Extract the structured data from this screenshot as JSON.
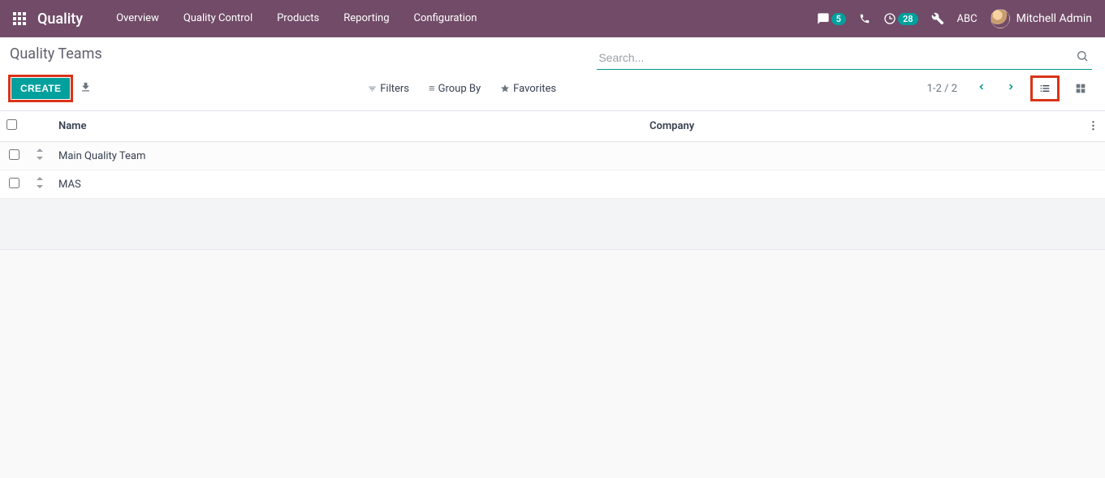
{
  "nav": {
    "brand": "Quality",
    "items": [
      "Overview",
      "Quality Control",
      "Products",
      "Reporting",
      "Configuration"
    ],
    "chat_badge": "5",
    "activity_badge": "28",
    "company": "ABC",
    "user": "Mitchell Admin"
  },
  "control": {
    "title": "Quality Teams",
    "create_label": "CREATE",
    "search_placeholder": "Search...",
    "filters_label": "Filters",
    "groupby_label": "Group By",
    "favorites_label": "Favorites",
    "pager": "1-2 / 2"
  },
  "table": {
    "col_name": "Name",
    "col_company": "Company",
    "rows": [
      {
        "name": "Main Quality Team",
        "company": ""
      },
      {
        "name": "MAS",
        "company": ""
      }
    ]
  }
}
